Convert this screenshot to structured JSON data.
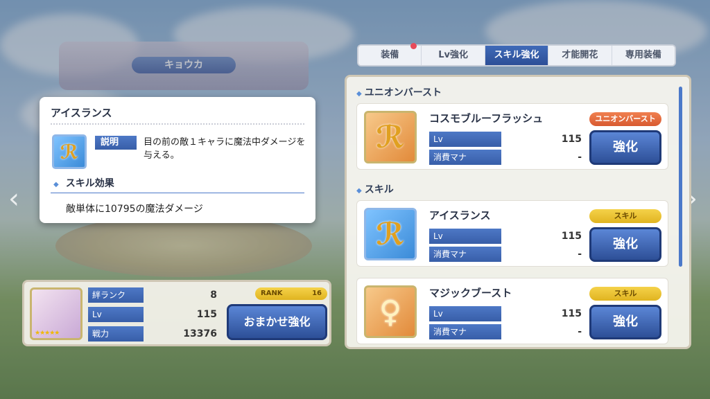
{
  "character": {
    "name": "キョウカ",
    "stats": [
      {
        "label": "絆ランク",
        "value": "8"
      },
      {
        "label": "Lv",
        "value": "115"
      },
      {
        "label": "戦力",
        "value": "13376"
      }
    ],
    "rank_label": "RANK",
    "rank_value": "16",
    "auto_button": "おまかせ強化",
    "stars": "★★★★★"
  },
  "tabs": [
    {
      "label": "装備",
      "active": false
    },
    {
      "label": "Lv強化",
      "active": false
    },
    {
      "label": "スキル強化",
      "active": true
    },
    {
      "label": "才能開花",
      "active": false
    },
    {
      "label": "専用装備",
      "active": false
    }
  ],
  "sections": {
    "union": "ユニオンバースト",
    "skill": "スキル"
  },
  "skills": [
    {
      "name": "コスモブルーフラッシュ",
      "badge": "ユニオンバースト",
      "lv_label": "Lv",
      "lv": "115",
      "mana_label": "消費マナ",
      "mana": "-",
      "button": "強化",
      "icon": "wand-icon"
    },
    {
      "name": "アイスランス",
      "badge": "スキル",
      "lv_label": "Lv",
      "lv": "115",
      "mana_label": "消費マナ",
      "mana": "-",
      "button": "強化",
      "icon": "ice-lance-icon"
    },
    {
      "name": "マジックブースト",
      "badge": "スキル",
      "lv_label": "Lv",
      "lv": "115",
      "mana_label": "消費マナ",
      "mana": "-",
      "button": "強化",
      "icon": "magic-boost-icon"
    }
  ],
  "popup": {
    "title": "アイスランス",
    "desc_label": "説明",
    "desc": "目の前の敵１キャラに魔法中ダメージを与える。",
    "effect_header": "スキル効果",
    "effect": "敵単体に10795の魔法ダメージ"
  },
  "nav": {
    "left": "‹",
    "right": "›"
  },
  "colors": {
    "accent": "#2d4f97",
    "badge_red": "#d85a30",
    "badge_gold": "#e0b420"
  }
}
